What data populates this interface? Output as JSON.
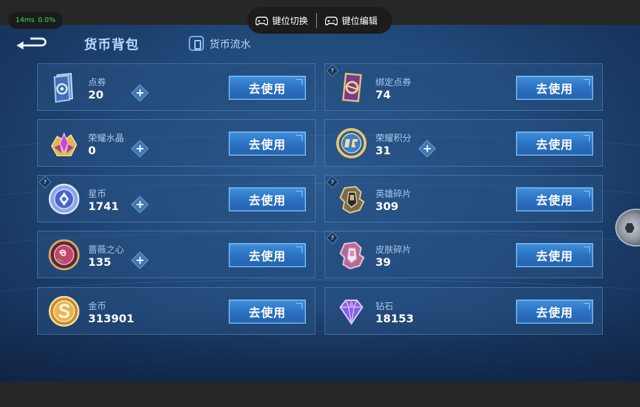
{
  "overlay": {
    "latency": "14ms",
    "loss": "0.0%",
    "switch_label": "键位切换",
    "edit_label": "键位编辑"
  },
  "header": {
    "title": "货币背包",
    "flow_tab": "货币流水"
  },
  "use_label": "去使用",
  "currencies": [
    {
      "name": "点券",
      "amount": "20"
    },
    {
      "name": "绑定点券",
      "amount": "74"
    },
    {
      "name": "荣耀水晶",
      "amount": "0"
    },
    {
      "name": "荣耀积分",
      "amount": "31"
    },
    {
      "name": "星币",
      "amount": "1741"
    },
    {
      "name": "英雄碎片",
      "amount": "309"
    },
    {
      "name": "蔷薇之心",
      "amount": "135"
    },
    {
      "name": "皮肤碎片",
      "amount": "39"
    },
    {
      "name": "金币",
      "amount": "313901"
    },
    {
      "name": "钻石",
      "amount": "18153"
    }
  ],
  "plus_label": "+",
  "qmark_label": "?",
  "colors": {
    "background": "#21497a",
    "button": "#2a6fc0",
    "ping_text": "#3fdc6b"
  }
}
